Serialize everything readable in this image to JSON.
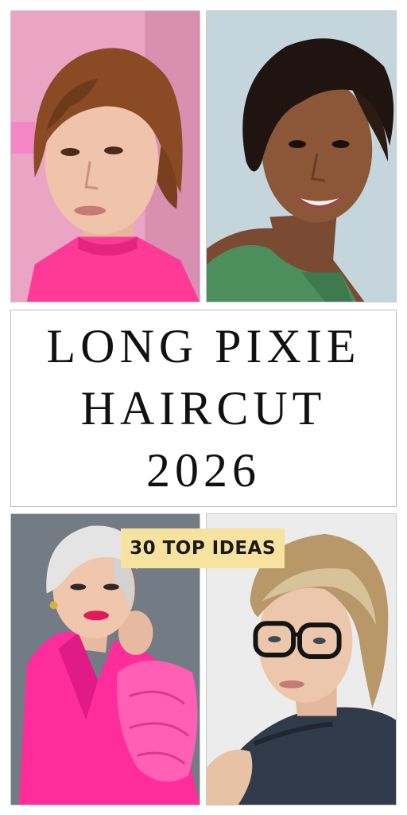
{
  "title": {
    "line1": "LONG PIXIE",
    "line2": "HAIRCUT",
    "line3": "2026"
  },
  "badge": {
    "label": "30 TOP IDEAS",
    "color": "#f7e3a0"
  },
  "photos": [
    {
      "name": "photo-auburn-shag-pixie",
      "bg": "#e88fb4",
      "top": "#ff3f9a"
    },
    {
      "name": "photo-dark-side-swept-pixie",
      "bg": "#b9d0d6",
      "top": "#4a8a58"
    },
    {
      "name": "photo-platinum-pixie",
      "bg": "#6f7780",
      "top": "#ff2fa0"
    },
    {
      "name": "photo-blonde-layered-pixie-glasses",
      "bg": "#e9e9e9",
      "top": "#2f3b4c"
    }
  ]
}
